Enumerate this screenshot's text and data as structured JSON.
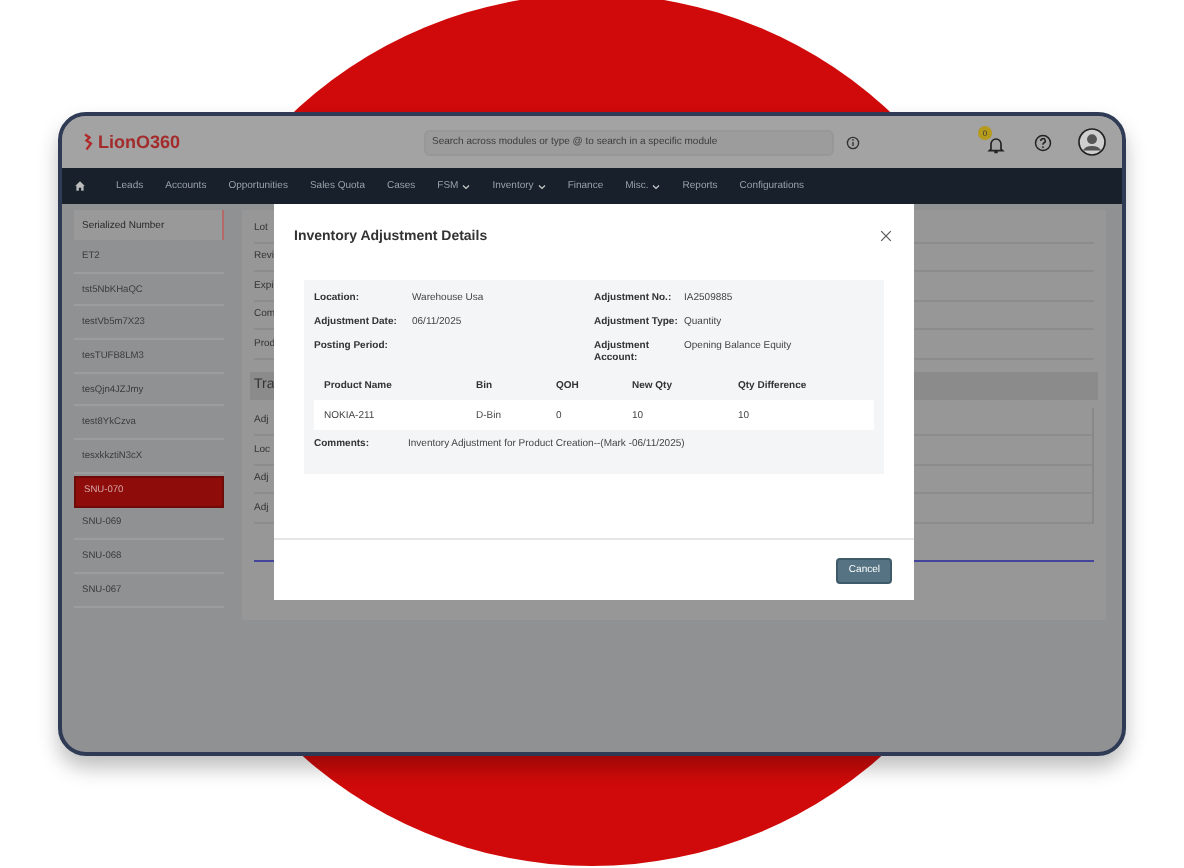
{
  "app": {
    "logo": "LionO360",
    "search": {
      "placeholder": "Search across modules or type @ to search in a specific module"
    },
    "notification_count": "0"
  },
  "nav": [
    {
      "label": "Leads",
      "dropdown": false
    },
    {
      "label": "Accounts",
      "dropdown": false
    },
    {
      "label": "Opportunities",
      "dropdown": false
    },
    {
      "label": "Sales Quota",
      "dropdown": false
    },
    {
      "label": "Cases",
      "dropdown": false
    },
    {
      "label": "FSM",
      "dropdown": true
    },
    {
      "label": "Inventory",
      "dropdown": true
    },
    {
      "label": "Finance",
      "dropdown": false
    },
    {
      "label": "Misc.",
      "dropdown": true
    },
    {
      "label": "Reports",
      "dropdown": false
    },
    {
      "label": "Configurations",
      "dropdown": false
    }
  ],
  "sidebar": {
    "heading": "Serialized Number",
    "items": [
      {
        "label": "ET2",
        "selected": false
      },
      {
        "label": "tst5NbKHaQC",
        "selected": false
      },
      {
        "label": "testVb5m7X23",
        "selected": false
      },
      {
        "label": "tesTUFB8LM3",
        "selected": false
      },
      {
        "label": "tesQjn4JZJmy",
        "selected": false
      },
      {
        "label": "test8YkCzva",
        "selected": false
      },
      {
        "label": "tesxkkztiN3cX",
        "selected": false
      },
      {
        "label": "SNU-070",
        "selected": true
      },
      {
        "label": "SNU-069",
        "selected": false
      },
      {
        "label": "SNU-068",
        "selected": false
      },
      {
        "label": "SNU-067",
        "selected": false
      }
    ]
  },
  "background_labels": [
    "Lot",
    "Revi",
    "Expi",
    "Com",
    "Prod"
  ],
  "background_section": {
    "title": "Tra",
    "labels": [
      "Adj",
      "Loc",
      "Adj",
      "Adj"
    ]
  },
  "modal": {
    "title": "Inventory Adjustment Details",
    "fields": [
      {
        "label": "Location:",
        "value": "Warehouse Usa"
      },
      {
        "label": "Adjustment No.:",
        "value": "IA2509885"
      },
      {
        "label": "Adjustment Date:",
        "value": "06/11/2025"
      },
      {
        "label": "Adjustment Type:",
        "value": "Quantity"
      },
      {
        "label": "Posting Period:"
      },
      {
        "label": "Adjustment Account:",
        "value": "Opening Balance Equity"
      }
    ],
    "table": {
      "columns": [
        "Product Name",
        "Bin",
        "QOH",
        "New Qty",
        "Qty Difference"
      ],
      "rows": [
        [
          "NOKIA-211",
          "D-Bin",
          "0",
          "10",
          "10"
        ]
      ]
    },
    "comments": {
      "label": "Comments:",
      "value": "Inventory Adjustment for Product Creation--(Mark -06/11/2025)"
    },
    "buttons": [
      "Cancel"
    ]
  }
}
